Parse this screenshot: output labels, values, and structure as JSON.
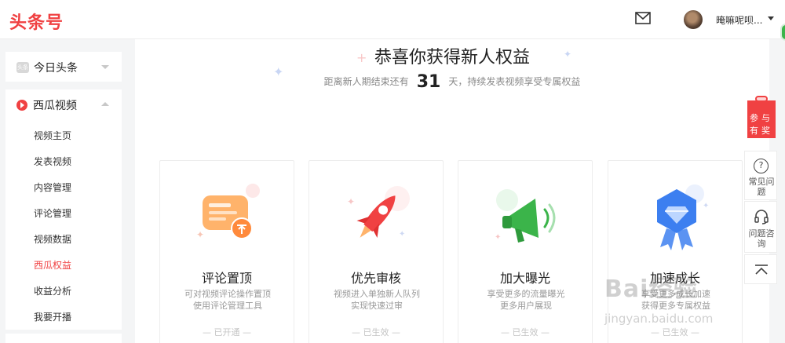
{
  "header": {
    "logo": "头条号",
    "username": "晻嘛呢呗...",
    "icons": {
      "mail": "mail-icon",
      "dropdown": "caret-down-icon"
    }
  },
  "sidebar": {
    "section1": {
      "label": "今日头条",
      "icon_text": "头条"
    },
    "section2": {
      "label": "西瓜视频",
      "items": [
        {
          "label": "视频主页"
        },
        {
          "label": "发表视频"
        },
        {
          "label": "内容管理"
        },
        {
          "label": "评论管理"
        },
        {
          "label": "视频数据"
        },
        {
          "label": "西瓜权益",
          "active": true
        },
        {
          "label": "收益分析"
        },
        {
          "label": "我要开播"
        }
      ]
    }
  },
  "main": {
    "title": "恭喜你获得新人权益",
    "subtitle_prefix": "距离新人期结束还有",
    "days_left": "31",
    "subtitle_suffix": "天，持续发表视频享受专属权益",
    "cards": [
      {
        "title": "评论置顶",
        "desc1": "可对视频评论操作置顶",
        "desc2": "使用评论管理工具",
        "status": "— 已开通 —",
        "icon": "comment-pin-icon"
      },
      {
        "title": "优先审核",
        "desc1": "视频进入单独新人队列",
        "desc2": "实现快速过审",
        "status": "— 已生效 —",
        "icon": "rocket-icon"
      },
      {
        "title": "加大曝光",
        "desc1": "享受更多的流量曝光",
        "desc2": "更多用户展现",
        "status": "— 已生效 —",
        "icon": "megaphone-icon"
      },
      {
        "title": "加速成长",
        "desc1": "享受更多成长加速",
        "desc2": "获得更多专属权益",
        "status": "— 已生效 —",
        "icon": "diamond-badge-icon"
      }
    ]
  },
  "right_toolbar": {
    "gift": "参与有奖",
    "help": "常见问题",
    "consult": "问题咨询"
  },
  "watermark": {
    "line1": "Bai经验",
    "line2": "jingyan.baidu.com"
  },
  "colors": {
    "brand": "#f04142",
    "green": "#3bb44a",
    "blue": "#3c7ff0",
    "orange": "#ff9a3c"
  }
}
